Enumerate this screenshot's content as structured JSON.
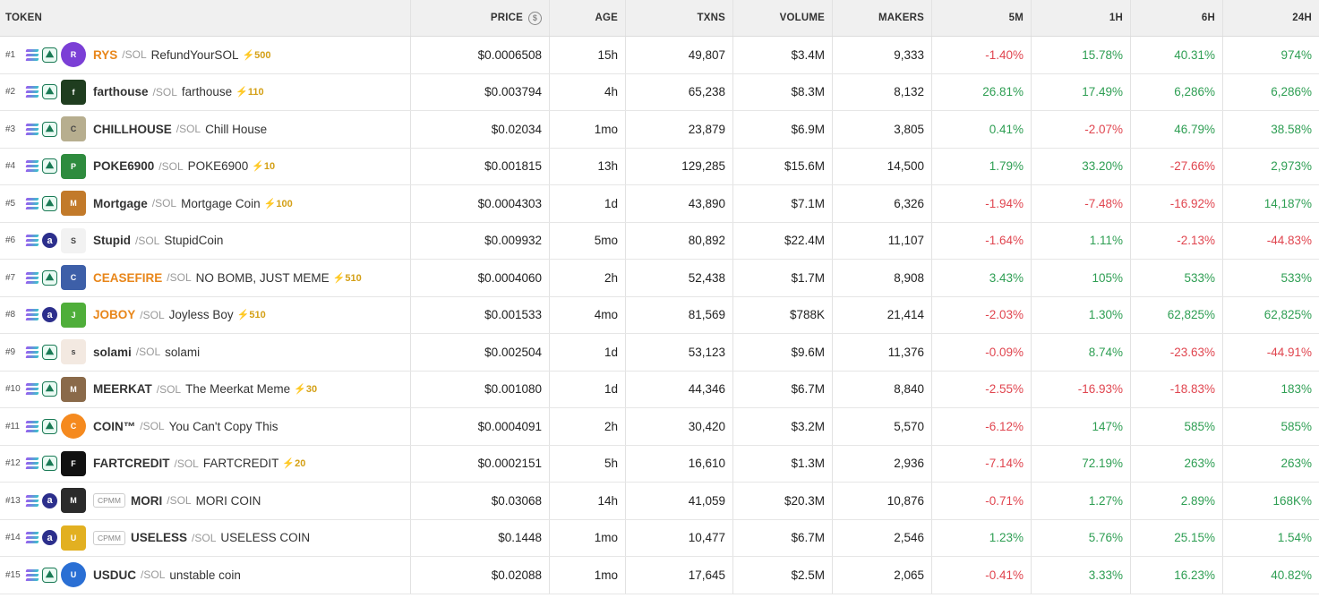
{
  "header": {
    "token": "TOKEN",
    "price": "PRICE",
    "age": "AGE",
    "txns": "TXNS",
    "volume": "VOLUME",
    "makers": "MAKERS",
    "m5": "5M",
    "h1": "1H",
    "h6": "6H",
    "h24": "24H"
  },
  "rows": [
    {
      "rank": "#1",
      "symbol": "RYS",
      "highlight": true,
      "pair": "/SOL",
      "name": "RefundYourSOL",
      "boost": "500",
      "price": "$0.0006508",
      "age": "15h",
      "txns": "49,807",
      "volume": "$3.4M",
      "makers": "9,333",
      "m5": "-1.40%",
      "h1": "15.78%",
      "h6": "40.31%",
      "h24": "974%",
      "avatar_color": "#7b3fd6",
      "dex": "pump"
    },
    {
      "rank": "#2",
      "symbol": "farthouse",
      "highlight": false,
      "pair": "/SOL",
      "name": "farthouse",
      "boost": "110",
      "price": "$0.003794",
      "age": "4h",
      "txns": "65,238",
      "volume": "$8.3M",
      "makers": "8,132",
      "m5": "26.81%",
      "h1": "17.49%",
      "h6": "6,286%",
      "h24": "6,286%",
      "avatar_color": "#1f3d1f",
      "dex": "pump"
    },
    {
      "rank": "#3",
      "symbol": "CHILLHOUSE",
      "highlight": false,
      "pair": "/SOL",
      "name": "Chill House",
      "boost": "",
      "price": "$0.02034",
      "age": "1mo",
      "txns": "23,879",
      "volume": "$6.9M",
      "makers": "3,805",
      "m5": "0.41%",
      "h1": "-2.07%",
      "h6": "46.79%",
      "h24": "38.58%",
      "avatar_color": "#b7ae8f",
      "dex": "pump"
    },
    {
      "rank": "#4",
      "symbol": "POKE6900",
      "highlight": false,
      "pair": "/SOL",
      "name": "POKE6900",
      "boost": "10",
      "price": "$0.001815",
      "age": "13h",
      "txns": "129,285",
      "volume": "$15.6M",
      "makers": "14,500",
      "m5": "1.79%",
      "h1": "33.20%",
      "h6": "-27.66%",
      "h24": "2,973%",
      "avatar_color": "#2e8b3e",
      "dex": "pump"
    },
    {
      "rank": "#5",
      "symbol": "Mortgage",
      "highlight": false,
      "pair": "/SOL",
      "name": "Mortgage Coin",
      "boost": "100",
      "price": "$0.0004303",
      "age": "1d",
      "txns": "43,890",
      "volume": "$7.1M",
      "makers": "6,326",
      "m5": "-1.94%",
      "h1": "-7.48%",
      "h6": "-16.92%",
      "h24": "14,187%",
      "avatar_color": "#c27a2a",
      "dex": "pump"
    },
    {
      "rank": "#6",
      "symbol": "Stupid",
      "highlight": false,
      "pair": "/SOL",
      "name": "StupidCoin",
      "boost": "",
      "price": "$0.009932",
      "age": "5mo",
      "txns": "80,892",
      "volume": "$22.4M",
      "makers": "11,107",
      "m5": "-1.64%",
      "h1": "1.11%",
      "h6": "-2.13%",
      "h24": "-44.83%",
      "avatar_color": "#f2f2f2",
      "dex": "alt"
    },
    {
      "rank": "#7",
      "symbol": "CEASEFIRE",
      "highlight": true,
      "pair": "/SOL",
      "name": "NO BOMB, JUST MEME",
      "boost": "510",
      "price": "$0.0004060",
      "age": "2h",
      "txns": "52,438",
      "volume": "$1.7M",
      "makers": "8,908",
      "m5": "3.43%",
      "h1": "105%",
      "h6": "533%",
      "h24": "533%",
      "avatar_color": "#3d5fa8",
      "dex": "pump"
    },
    {
      "rank": "#8",
      "symbol": "JOBOY",
      "highlight": true,
      "pair": "/SOL",
      "name": "Joyless Boy",
      "boost": "510",
      "price": "$0.001533",
      "age": "4mo",
      "txns": "81,569",
      "volume": "$788K",
      "makers": "21,414",
      "m5": "-2.03%",
      "h1": "1.30%",
      "h6": "62,825%",
      "h24": "62,825%",
      "avatar_color": "#4fae3a",
      "dex": "alt"
    },
    {
      "rank": "#9",
      "symbol": "solami",
      "highlight": false,
      "pair": "/SOL",
      "name": "solami",
      "boost": "",
      "price": "$0.002504",
      "age": "1d",
      "txns": "53,123",
      "volume": "$9.6M",
      "makers": "11,376",
      "m5": "-0.09%",
      "h1": "8.74%",
      "h6": "-23.63%",
      "h24": "-44.91%",
      "avatar_color": "#f3e9e1",
      "dex": "pump"
    },
    {
      "rank": "#10",
      "symbol": "MEERKAT",
      "highlight": false,
      "pair": "/SOL",
      "name": "The Meerkat Meme",
      "boost": "30",
      "price": "$0.001080",
      "age": "1d",
      "txns": "44,346",
      "volume": "$6.7M",
      "makers": "8,840",
      "m5": "-2.55%",
      "h1": "-16.93%",
      "h6": "-18.83%",
      "h24": "183%",
      "avatar_color": "#8a6a4a",
      "dex": "pump"
    },
    {
      "rank": "#11",
      "symbol": "COIN™",
      "highlight": false,
      "pair": "/SOL",
      "name": "You Can't Copy This",
      "boost": "",
      "price": "$0.0004091",
      "age": "2h",
      "txns": "30,420",
      "volume": "$3.2M",
      "makers": "5,570",
      "m5": "-6.12%",
      "h1": "147%",
      "h6": "585%",
      "h24": "585%",
      "avatar_color": "#f58a1f",
      "dex": "pump"
    },
    {
      "rank": "#12",
      "symbol": "FARTCREDIT",
      "highlight": false,
      "pair": "/SOL",
      "name": "FARTCREDIT",
      "boost": "20",
      "price": "$0.0002151",
      "age": "5h",
      "txns": "16,610",
      "volume": "$1.3M",
      "makers": "2,936",
      "m5": "-7.14%",
      "h1": "72.19%",
      "h6": "263%",
      "h24": "263%",
      "avatar_color": "#111111",
      "dex": "pump"
    },
    {
      "rank": "#13",
      "symbol": "MORI",
      "highlight": false,
      "pair": "/SOL",
      "name": "MORI COIN",
      "boost": "",
      "cpmm": "CPMM",
      "price": "$0.03068",
      "age": "14h",
      "txns": "41,059",
      "volume": "$20.3M",
      "makers": "10,876",
      "m5": "-0.71%",
      "h1": "1.27%",
      "h6": "2.89%",
      "h24": "168K%",
      "avatar_color": "#2b2b2b",
      "dex": "alt"
    },
    {
      "rank": "#14",
      "symbol": "USELESS",
      "highlight": false,
      "pair": "/SOL",
      "name": "USELESS COIN",
      "boost": "",
      "cpmm": "CPMM",
      "price": "$0.1448",
      "age": "1mo",
      "txns": "10,477",
      "volume": "$6.7M",
      "makers": "2,546",
      "m5": "1.23%",
      "h1": "5.76%",
      "h6": "25.15%",
      "h24": "1.54%",
      "avatar_color": "#e2b021",
      "dex": "alt"
    },
    {
      "rank": "#15",
      "symbol": "USDUC",
      "highlight": false,
      "pair": "/SOL",
      "name": "unstable coin",
      "boost": "",
      "price": "$0.02088",
      "age": "1mo",
      "txns": "17,645",
      "volume": "$2.5M",
      "makers": "2,065",
      "m5": "-0.41%",
      "h1": "3.33%",
      "h6": "16.23%",
      "h24": "40.82%",
      "avatar_color": "#2a6fd4",
      "dex": "pump"
    }
  ],
  "colors": {
    "positive": "#2e9e53",
    "negative": "#e0454f",
    "highlight": "#e8861a",
    "boost": "#d4a017"
  }
}
